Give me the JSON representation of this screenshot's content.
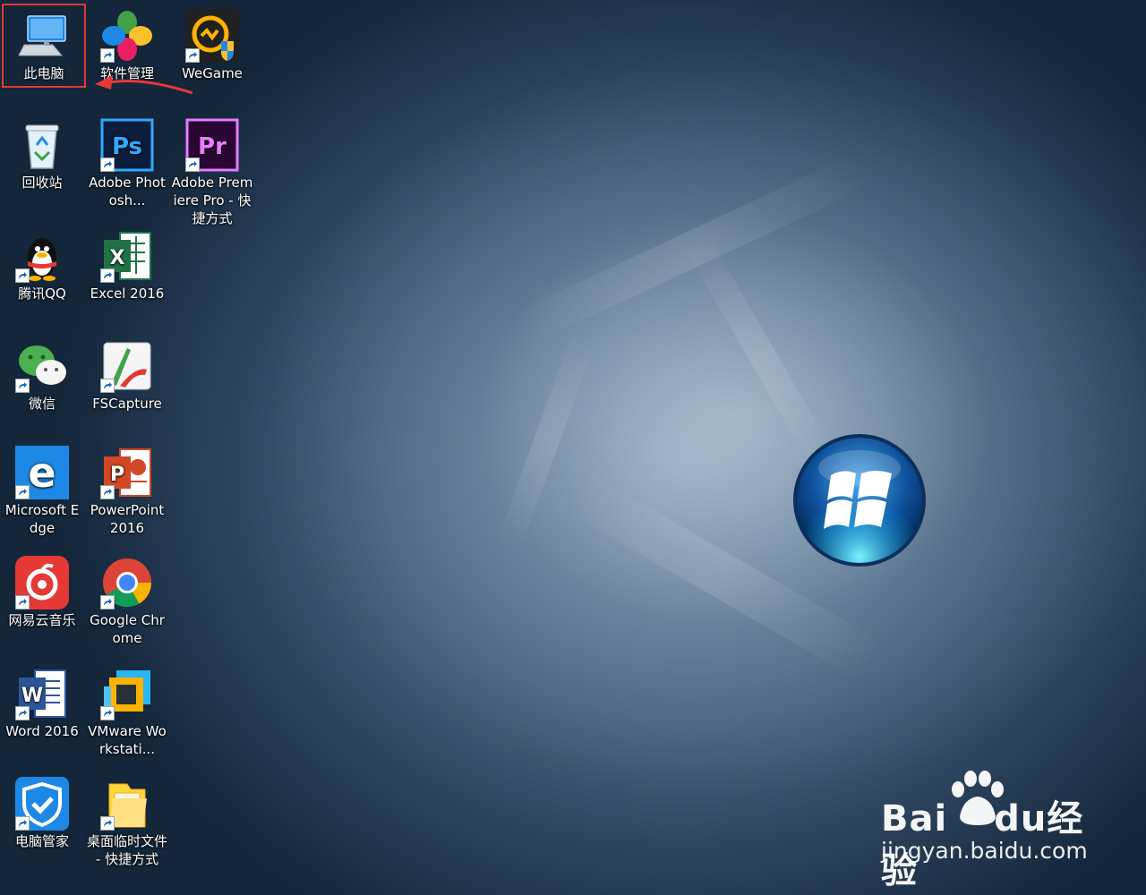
{
  "desktop": {
    "icons": [
      {
        "id": "this-pc",
        "label": "此电脑"
      },
      {
        "id": "software-manager",
        "label": "软件管理"
      },
      {
        "id": "wegame",
        "label": "WeGame"
      },
      {
        "id": "recycle-bin",
        "label": "回收站"
      },
      {
        "id": "photoshop",
        "label": "Adobe Photosh..."
      },
      {
        "id": "premiere",
        "label": "Adobe Premiere Pro - 快捷方式"
      },
      {
        "id": "qq",
        "label": "腾讯QQ"
      },
      {
        "id": "excel",
        "label": "Excel 2016"
      },
      {
        "id": "wechat",
        "label": "微信"
      },
      {
        "id": "fscapture",
        "label": "FSCapture"
      },
      {
        "id": "edge",
        "label": "Microsoft Edge"
      },
      {
        "id": "powerpoint",
        "label": "PowerPoint 2016"
      },
      {
        "id": "netease-music",
        "label": "网易云音乐"
      },
      {
        "id": "chrome",
        "label": "Google Chrome"
      },
      {
        "id": "word",
        "label": "Word 2016"
      },
      {
        "id": "vmware",
        "label": "VMware Workstati..."
      },
      {
        "id": "pc-manager",
        "label": "电脑管家"
      },
      {
        "id": "temp-folder",
        "label": "桌面临时文件 - 快捷方式"
      }
    ],
    "selected_icon": "此电脑"
  },
  "watermark": {
    "brand_left": "Bai",
    "brand_mid": "du",
    "brand_right": "经验",
    "url": "jingyan.baidu.com"
  },
  "colors": {
    "highlight_box": "#e53935",
    "arrow": "#e53935"
  }
}
